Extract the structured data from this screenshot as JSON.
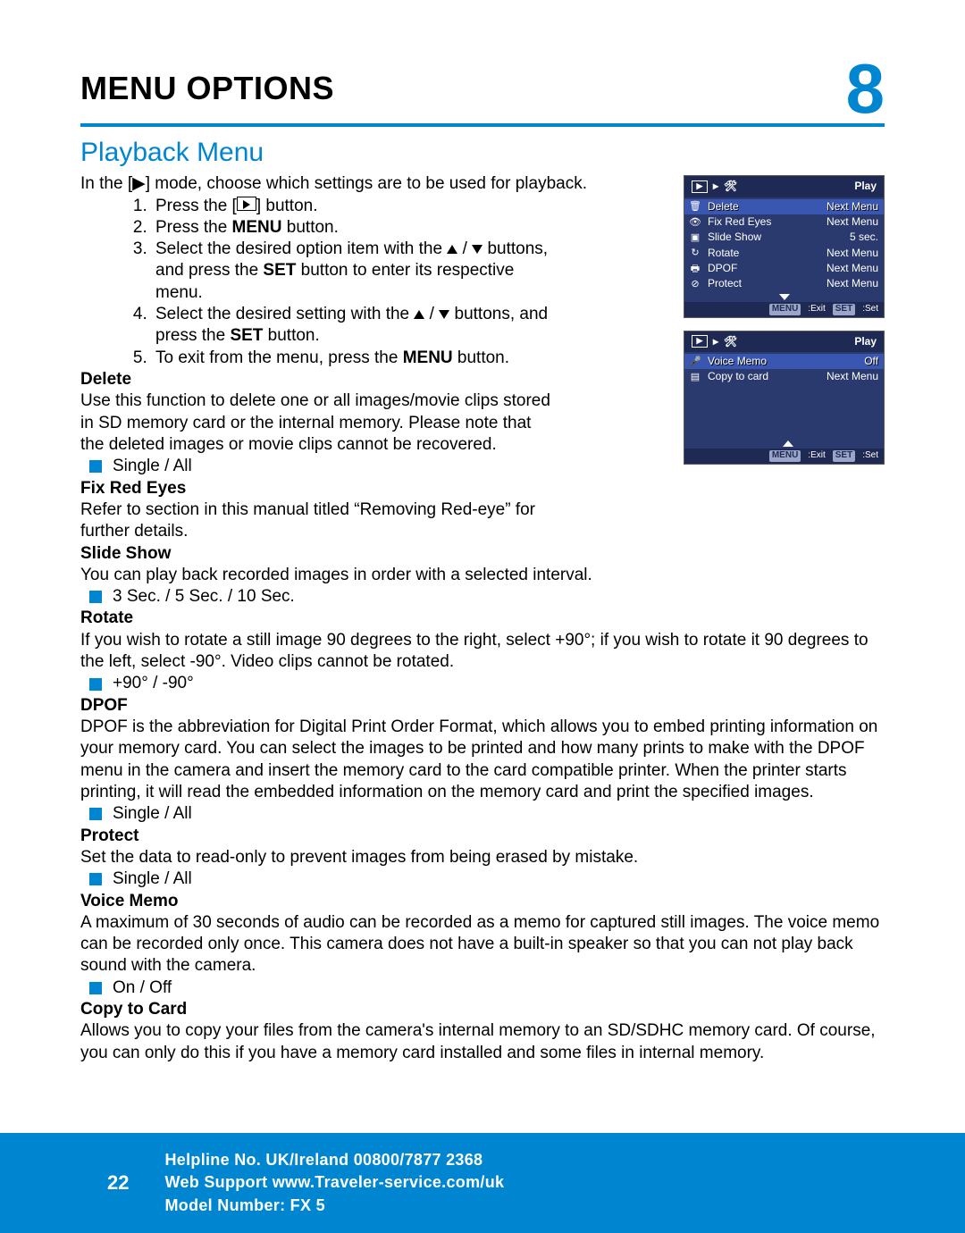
{
  "header": {
    "title": "MENU OPTIONS",
    "chapter": "8"
  },
  "section": "Playback Menu",
  "intro": "In the [▶] mode, choose which settings are to be used for playback.",
  "steps": {
    "s1a": "Press the [",
    "s1b": "] button.",
    "s2a": "Press the ",
    "s2b": "MENU",
    "s2c": " button.",
    "s3a": "Select the desired option item with the ",
    "s3b": " / ",
    "s3c": " buttons, and press the ",
    "s3d": "SET",
    "s3e": " button to enter its respective menu.",
    "s4a": "Select the desired setting with the ",
    "s4b": " / ",
    "s4c": " buttons, and press the ",
    "s4d": "SET",
    "s4e": " button.",
    "s5a": "To exit from the menu, press the ",
    "s5b": "MENU",
    "s5c": " button."
  },
  "items": {
    "delete": {
      "h": "Delete",
      "p": "Use this function to delete one or all images/movie clips stored in SD memory card or  the internal memory. Please note that the deleted images or movie clips cannot be recovered.",
      "opt": "Single / All"
    },
    "fix": {
      "h": "Fix Red Eyes",
      "p": "Refer to section in this manual titled “Removing Red-eye” for further details."
    },
    "slide": {
      "h": "Slide Show",
      "p": "You can play back recorded images in order with a selected interval.",
      "opt": "3 Sec. / 5 Sec. / 10 Sec."
    },
    "rotate": {
      "h": "Rotate",
      "p": "If you wish to rotate a still image 90 degrees to the right, select +90°; if you wish to rotate it 90 degrees to the left, select -90°. Video clips cannot be rotated.",
      "opt": " +90° / -90°"
    },
    "dpof": {
      "h": "DPOF",
      "p": "DPOF is the abbreviation for Digital Print Order Format, which allows you to embed printing information on your memory card. You can select the images to be printed and how many prints to make with the DPOF menu in the camera and insert the memory card to the card compatible printer. When the printer starts printing, it will read the embedded information on the memory card and print the specified images.",
      "opt": "Single / All"
    },
    "protect": {
      "h": "Protect",
      "p": "Set the data to read-only to prevent images from being erased by mistake.",
      "opt": "Single / All"
    },
    "voice": {
      "h": "Voice Memo",
      "p": "A maximum of 30 seconds of audio can be recorded as a memo for captured still images. The voice memo can be recorded only once. This camera does not have a built-in speaker so that you can not play back sound with the camera.",
      "opt": "On / Off"
    },
    "copy": {
      "h": "Copy to Card",
      "p": "Allows you to copy your files from the camera's internal memory to an SD/SDHC memory card. Of course, you can only do this if you have a memory card installed and some files in internal memory."
    }
  },
  "lcd1": {
    "title": "Play",
    "rows": [
      {
        "label": "Delete",
        "value": "Next Menu"
      },
      {
        "label": "Fix Red Eyes",
        "value": "Next Menu"
      },
      {
        "label": "Slide Show",
        "value": "5 sec."
      },
      {
        "label": "Rotate",
        "value": "Next Menu"
      },
      {
        "label": "DPOF",
        "value": "Next Menu"
      },
      {
        "label": "Protect",
        "value": "Next Menu"
      }
    ],
    "foot_menu": "MENU",
    "foot_exit": ":Exit",
    "foot_set": "SET",
    "foot_set2": ":Set"
  },
  "lcd2": {
    "title": "Play",
    "rows": [
      {
        "label": "Voice Memo",
        "value": "Off"
      },
      {
        "label": "Copy to card",
        "value": "Next Menu"
      }
    ],
    "foot_menu": "MENU",
    "foot_exit": ":Exit",
    "foot_set": "SET",
    "foot_set2": ":Set"
  },
  "footer": {
    "page": "22",
    "line1": "Helpline No. UK/Ireland 00800/7877 2368",
    "line2": "Web Support www.Traveler-service.com/uk",
    "line3": "Model Number: FX 5"
  }
}
